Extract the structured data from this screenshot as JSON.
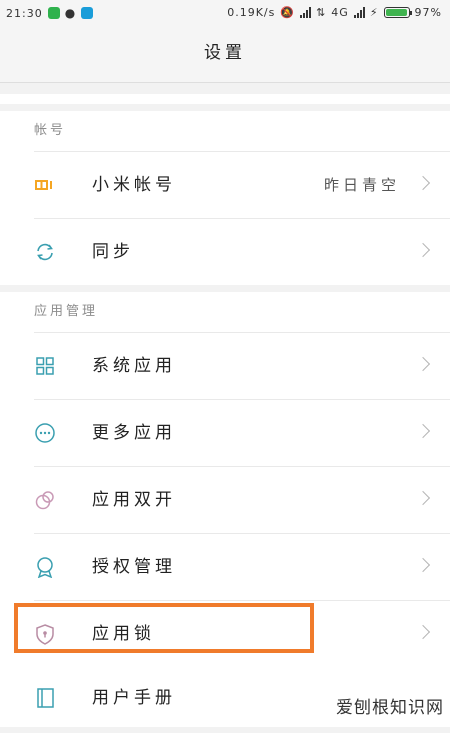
{
  "status_bar": {
    "time": "21:30",
    "speed": "0.19K/s",
    "network": "4G",
    "battery": "97%",
    "battery_level": 0.97,
    "colors": {
      "app1": "#2fb24d",
      "app3": "#1a9dd9",
      "battery": "#3fb34f"
    }
  },
  "header": {
    "title": "设置"
  },
  "account_section": {
    "title": "帐号",
    "items": [
      {
        "icon": "mi-logo-icon",
        "label": "小米帐号",
        "value": "昨日青空"
      },
      {
        "icon": "sync-icon",
        "label": "同步"
      }
    ]
  },
  "apps_section": {
    "title": "应用管理",
    "items": [
      {
        "icon": "grid-icon",
        "label": "系统应用"
      },
      {
        "icon": "more-dots-icon",
        "label": "更多应用"
      },
      {
        "icon": "dual-circle-icon",
        "label": "应用双开"
      },
      {
        "icon": "badge-icon",
        "label": "授权管理"
      },
      {
        "icon": "shield-lock-icon",
        "label": "应用锁"
      }
    ]
  },
  "help_section": {
    "items": [
      {
        "icon": "manual-icon",
        "label": "用户手册"
      }
    ]
  },
  "colors": {
    "accent_orange": "#f07b2b",
    "mi_orange": "#f5a623",
    "icon_teal": "#3a9fb0"
  },
  "watermark": "爱刨根知识网"
}
